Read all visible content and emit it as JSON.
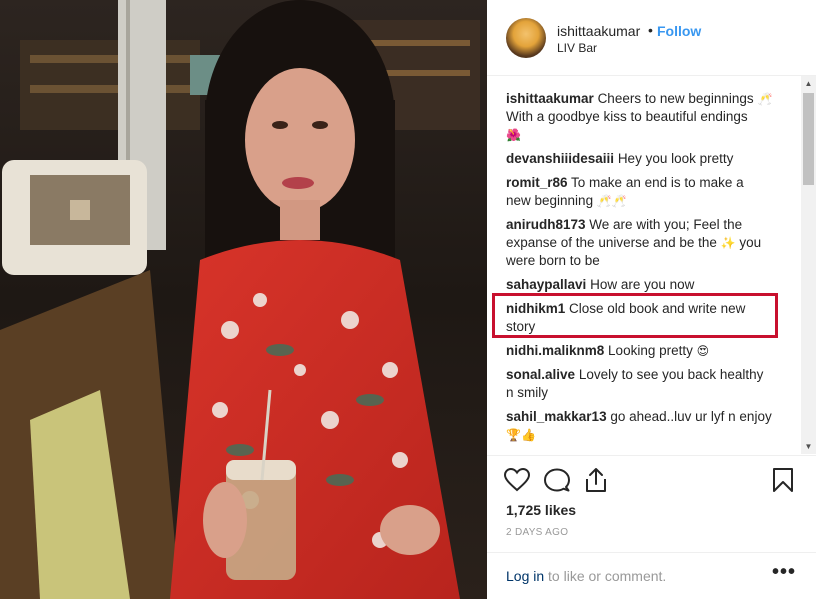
{
  "post": {
    "username": "ishittaakumar",
    "separator": "•",
    "follow_label": "Follow",
    "location": "LIV Bar"
  },
  "comments": [
    {
      "user": "ishittaakumar",
      "text": "Cheers to new beginnings",
      "emoji": "🥂",
      "line2": "With a goodbye kiss to beautiful endings",
      "line3_emoji": "🌺"
    },
    {
      "user": "devanshiiidesaiii",
      "text": "Hey you look pretty"
    },
    {
      "user": "romit_r86",
      "text": "To make an end is to make a",
      "line2": "new beginning",
      "line2_emoji": "🥂🥂"
    },
    {
      "user": "anirudh8173",
      "text": "We are with you; Feel the",
      "line2": "expanse of the universe and be the",
      "line2_emoji": "✨",
      "line2_after": "you",
      "line3": "were born to be"
    },
    {
      "user": "sahaypallavi",
      "text": "How are you now"
    },
    {
      "user": "nidhikm1",
      "text": "Close old book and write new",
      "line2": "story"
    },
    {
      "user": "nidhi.maliknm8",
      "text": "Looking pretty",
      "emoji": "😍"
    },
    {
      "user": "sonal.alive",
      "text": "Lovely to see you back healthy",
      "line2": "n smily"
    },
    {
      "user": "sahil_makkar13",
      "text": "go ahead..luv ur lyf n enjoy",
      "line2_emoji": "🏆👍"
    }
  ],
  "actions": {
    "likes": "1,725 likes",
    "time": "2 DAYS AGO",
    "login_link": "Log in",
    "login_rest": " to like or comment.",
    "more": "•••"
  },
  "icons": {
    "heart": "heart-icon",
    "comment": "comment-icon",
    "share": "share-icon",
    "bookmark": "bookmark-icon"
  },
  "colors": {
    "follow": "#3897f0",
    "highlight": "#c8102e",
    "muted": "#999999"
  }
}
